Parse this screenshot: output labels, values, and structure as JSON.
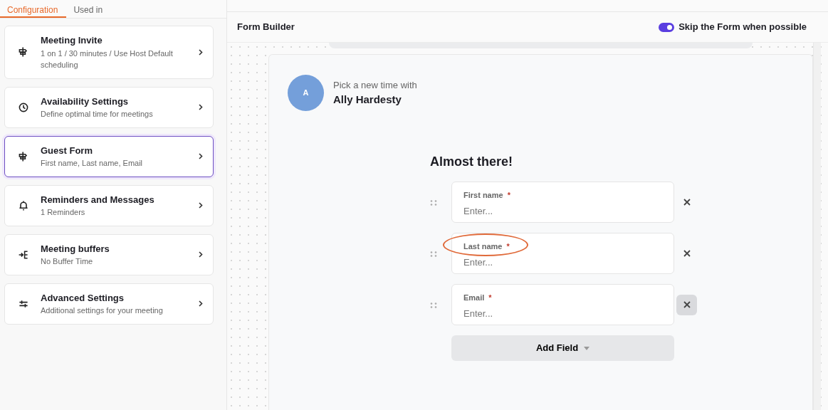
{
  "tabs": [
    {
      "label": "Configuration",
      "selected": true
    },
    {
      "label": "Used in",
      "selected": false
    }
  ],
  "sidebar": {
    "items": [
      {
        "kind": "signpost",
        "title": "Meeting Invite",
        "subtitle": "1 on 1 / 30 minutes / Use Host Default scheduling",
        "selected": false
      },
      {
        "kind": "clock",
        "title": "Availability Settings",
        "subtitle": "Define optimal time for meetings",
        "selected": false
      },
      {
        "kind": "signpost",
        "title": "Guest Form",
        "subtitle": "First name, Last name, Email",
        "selected": true
      },
      {
        "kind": "bell",
        "title": "Reminders and Messages",
        "subtitle": "1 Reminders",
        "selected": false
      },
      {
        "kind": "buffers",
        "title": "Meeting buffers",
        "subtitle": "No Buffer Time",
        "selected": false
      },
      {
        "kind": "sliders",
        "title": "Advanced Settings",
        "subtitle": "Additional settings for your meeting",
        "selected": false
      }
    ]
  },
  "form_builder": {
    "title": "Form Builder",
    "skip_toggle": {
      "label": "Skip the Form when possible",
      "on": true
    }
  },
  "preview": {
    "avatar": "A",
    "intro": "Pick a new time with",
    "host": "Ally Hardesty",
    "heading": "Almost there!",
    "fields": [
      {
        "label": "First name",
        "required_mark": "*",
        "placeholder": "Enter...",
        "circled": false,
        "remove_hovered": false
      },
      {
        "label": "Last name",
        "required_mark": "*",
        "placeholder": "Enter...",
        "circled": true,
        "remove_hovered": false
      },
      {
        "label": "Email",
        "required_mark": "*",
        "placeholder": "Enter...",
        "circled": false,
        "remove_hovered": true
      }
    ],
    "add_button": "Add Field"
  }
}
